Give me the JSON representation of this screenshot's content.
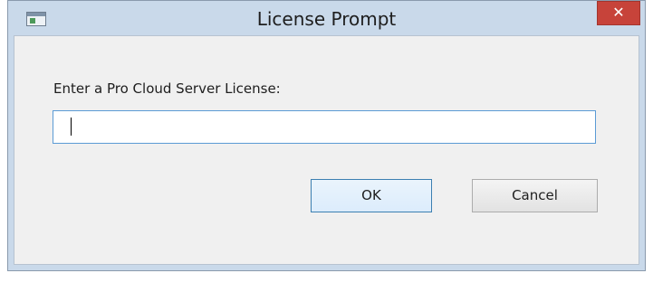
{
  "window": {
    "title": "License Prompt",
    "close_glyph": "✕",
    "icon": "application-window-icon"
  },
  "form": {
    "prompt_label": "Enter a Pro Cloud Server License:",
    "license_value": "",
    "license_placeholder": ""
  },
  "buttons": {
    "ok_label": "OK",
    "cancel_label": "Cancel"
  },
  "colors": {
    "titlebar": "#c9d9ea",
    "close_button": "#c7433a",
    "input_focus_border": "#5b9bd5",
    "default_button_border": "#3c7fb1"
  }
}
